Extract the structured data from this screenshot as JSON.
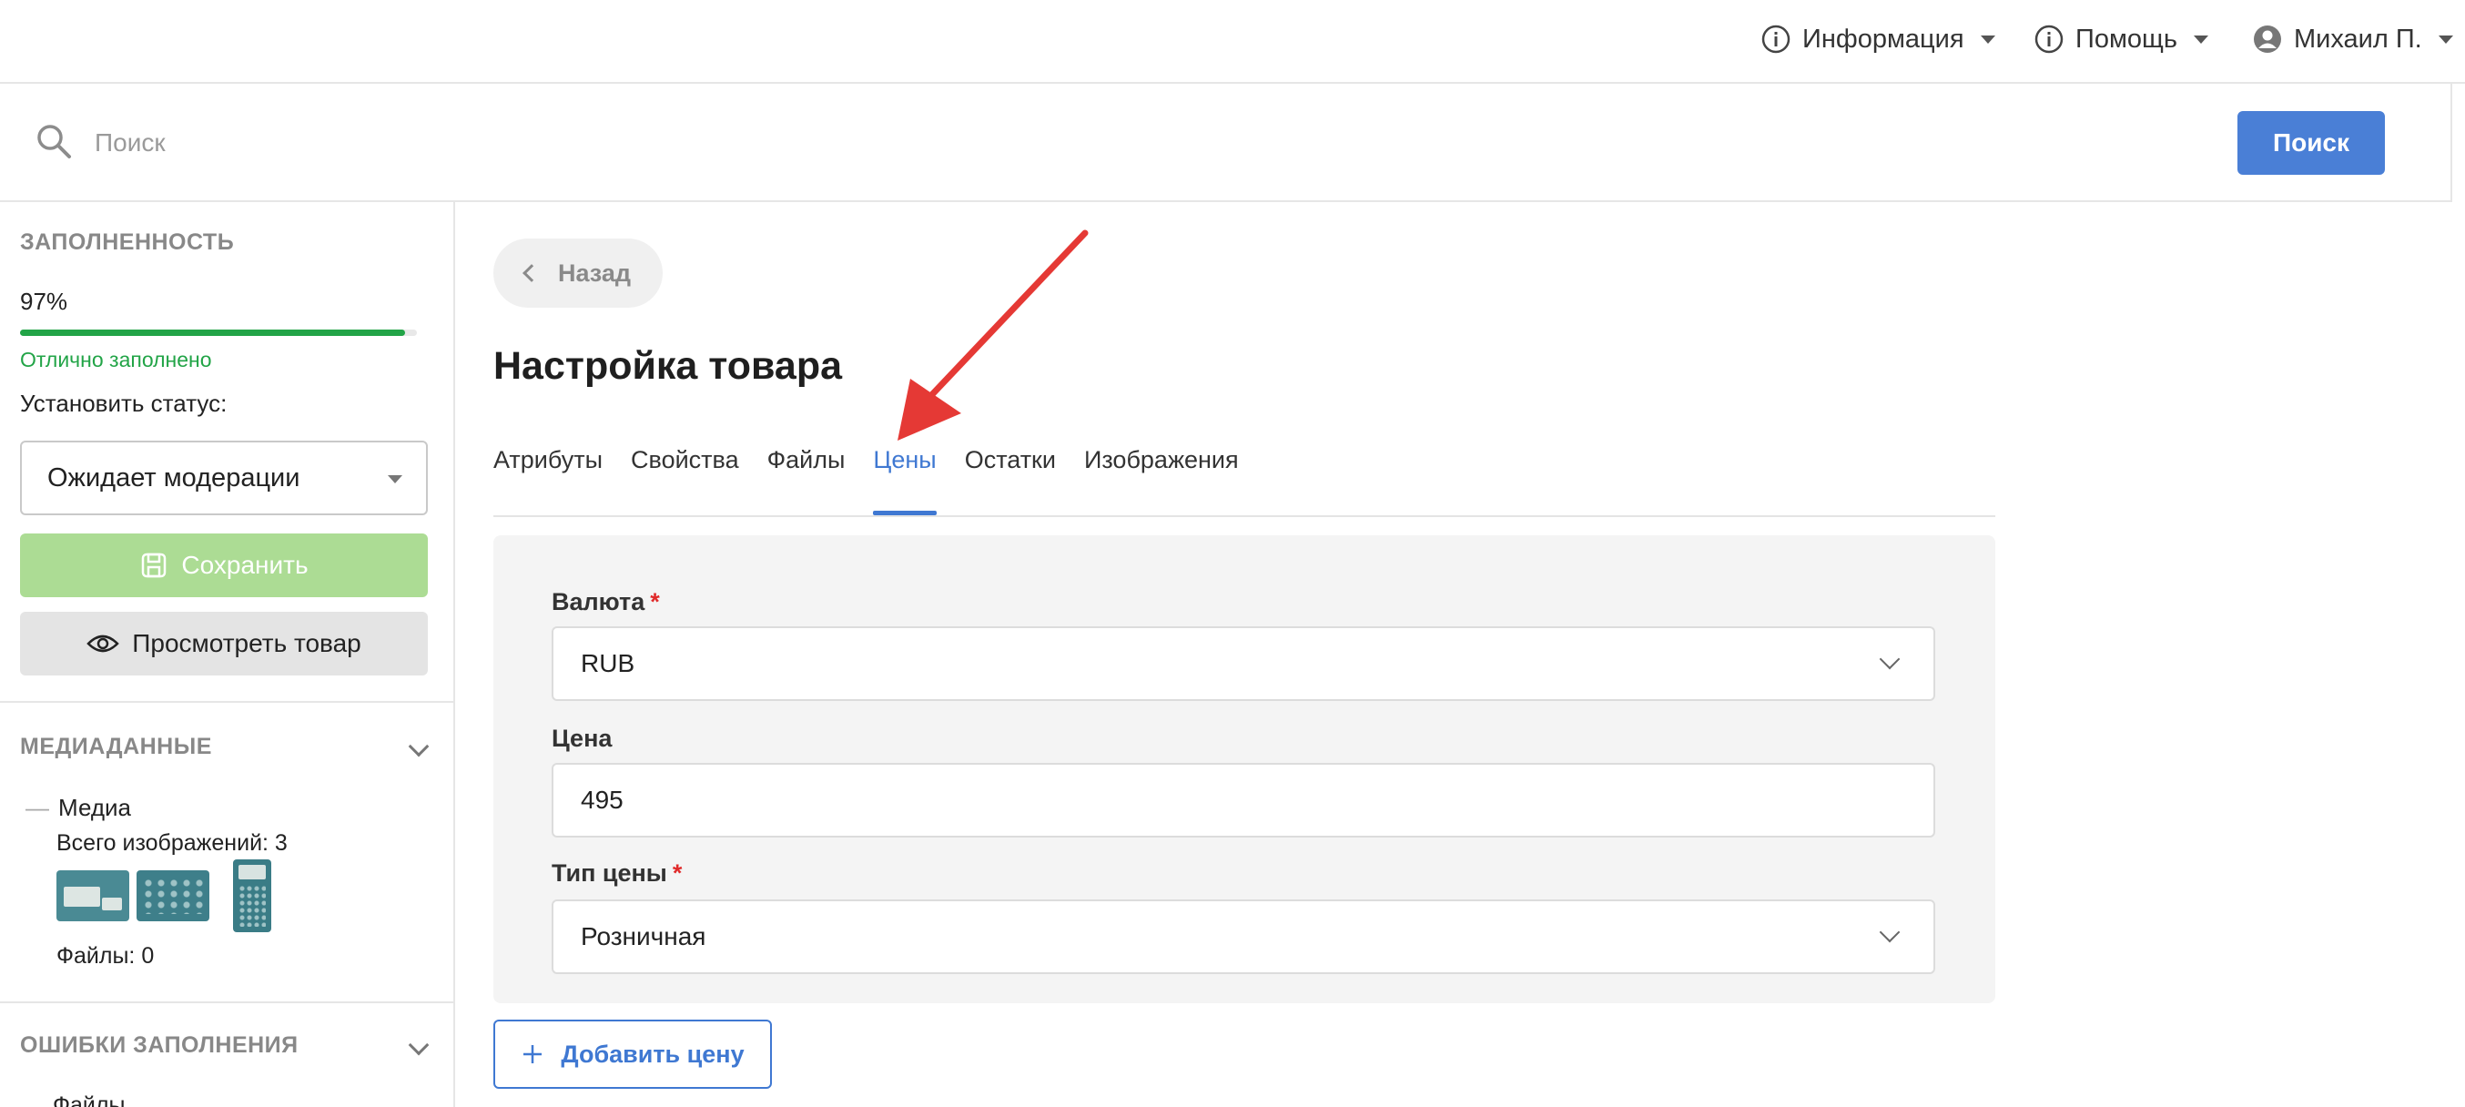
{
  "topnav": {
    "info_label": "Информация",
    "help_label": "Помощь",
    "user_label": "Михаил П."
  },
  "search": {
    "placeholder": "Поиск",
    "button_label": "Поиск"
  },
  "sidebar": {
    "fill_heading": "ЗАПОЛНЕННОСТЬ",
    "fill_percent": "97%",
    "fill_value": 0.97,
    "fill_status": "Отлично заполнено",
    "set_status_label": "Установить статус:",
    "status_value": "Ожидает модерации",
    "save_label": "Сохранить",
    "view_label": "Просмотреть товар",
    "media_heading": "МЕДИАДАННЫЕ",
    "media_tree_label": "Медиа",
    "images_total": "Всего изображений: 3",
    "files_count": "Файлы: 0",
    "errors_heading": "ОШИБКИ ЗАПОЛНЕНИЯ",
    "errors_first_item": "Файлы"
  },
  "main": {
    "back_label": "Назад",
    "title": "Настройка товара",
    "tabs": [
      {
        "label": "Атрибуты"
      },
      {
        "label": "Свойства"
      },
      {
        "label": "Файлы"
      },
      {
        "label": "Цены"
      },
      {
        "label": "Остатки"
      },
      {
        "label": "Изображения"
      }
    ],
    "active_tab": "Цены",
    "currency_label": "Валюта",
    "currency_value": "RUB",
    "price_label": "Цена",
    "price_value": "495",
    "price_type_label": "Тип цены",
    "price_type_value": "Розничная",
    "required_mark": "*",
    "add_price_label": "Добавить цену"
  },
  "colors": {
    "accent": "#3f78d2",
    "search_button": "#4a7fd6",
    "progress": "#22a447",
    "save_disabled": "#acdc94",
    "required": "#e02a2a",
    "annotation_arrow": "#e53935"
  }
}
